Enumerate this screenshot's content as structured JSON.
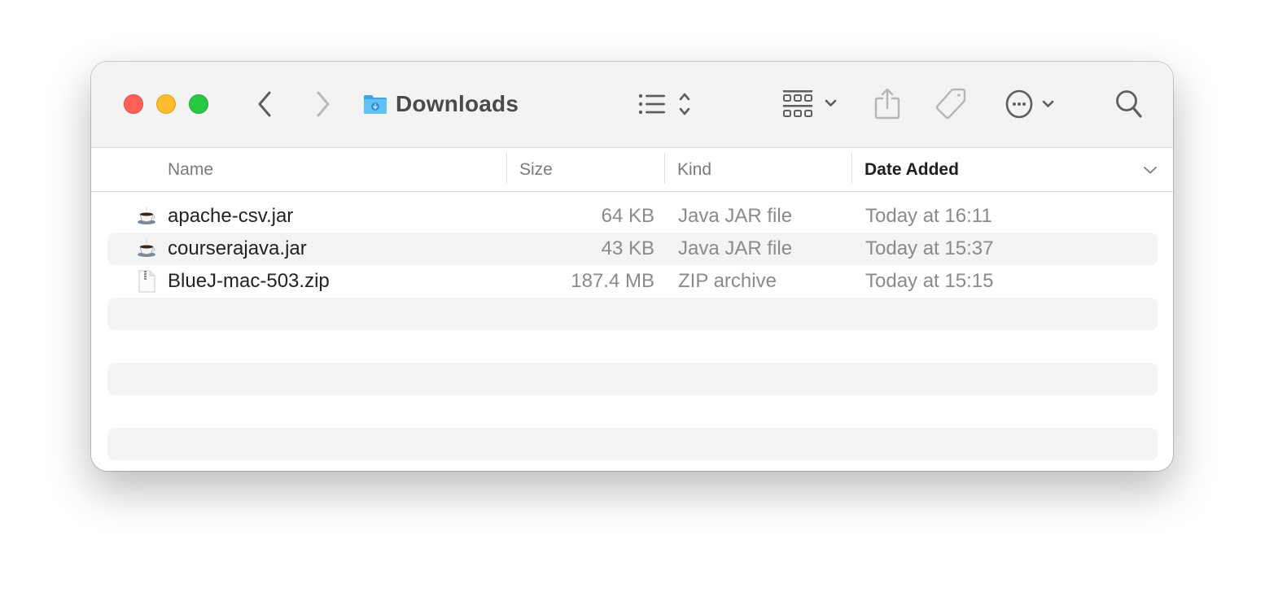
{
  "window": {
    "title": "Downloads",
    "traffic_lights": {
      "close": "#fe5f57",
      "minimize": "#febc2e",
      "maximize": "#28c840"
    }
  },
  "toolbar": {
    "back_icon": "chevron-left-icon",
    "forward_icon": "chevron-right-icon",
    "folder_icon": "downloads-folder-icon",
    "view_icon": "list-view-icon",
    "group_icon": "group-by-grid-icon",
    "share_icon": "share-icon",
    "tag_icon": "tag-icon",
    "action_icon": "more-actions-icon",
    "search_icon": "search-icon",
    "folder_color": "#4fb3ec"
  },
  "columns": [
    {
      "label": "Name",
      "active": false
    },
    {
      "label": "Size",
      "active": false
    },
    {
      "label": "Kind",
      "active": false
    },
    {
      "label": "Date Added",
      "active": true,
      "sort": "descending"
    }
  ],
  "files": [
    {
      "name": "apache-csv.jar",
      "size": "64 KB",
      "kind": "Java JAR file",
      "date_added": "Today at 16:11",
      "icon": "java-cup-icon"
    },
    {
      "name": "courserajava.jar",
      "size": "43 KB",
      "kind": "Java JAR file",
      "date_added": "Today at 15:37",
      "icon": "java-cup-icon"
    },
    {
      "name": "BlueJ-mac-503.zip",
      "size": "187.4 MB",
      "kind": "ZIP archive",
      "date_added": "Today at 15:15",
      "icon": "zip-file-icon"
    }
  ]
}
